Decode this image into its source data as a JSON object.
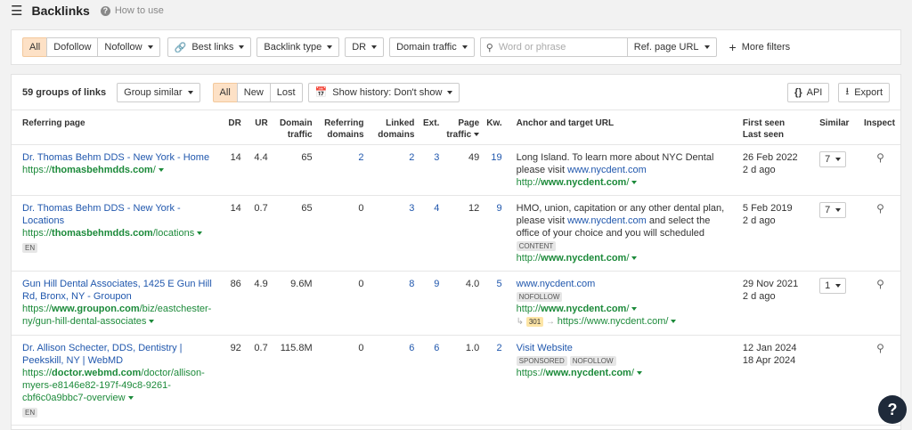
{
  "header": {
    "title": "Backlinks",
    "how_to": "How to use"
  },
  "filters": {
    "all": "All",
    "dofollow": "Dofollow",
    "nofollow": "Nofollow",
    "best_links": "Best links",
    "backlink_type": "Backlink type",
    "dr": "DR",
    "domain_traffic": "Domain traffic",
    "search_placeholder": "Word or phrase",
    "ref_page_url": "Ref. page URL",
    "more_filters": "More filters"
  },
  "toolbar": {
    "count": "59 groups of links",
    "group_similar": "Group similar",
    "all": "All",
    "new": "New",
    "lost": "Lost",
    "show_history": "Show history: Don't show",
    "api": "API",
    "export": "Export"
  },
  "columns": {
    "referring_page": "Referring page",
    "dr": "DR",
    "ur": "UR",
    "domain_traffic": "Domain traffic",
    "referring_domains": "Referring domains",
    "linked_domains": "Linked domains",
    "ext": "Ext.",
    "page_traffic": "Page traffic",
    "kw": "Kw.",
    "anchor": "Anchor and target URL",
    "first_seen": "First seen",
    "last_seen": "Last seen",
    "similar": "Similar",
    "inspect": "Inspect"
  },
  "rows": [
    {
      "title": "Dr. Thomas Behm DDS - New York - Home",
      "url_pre": "https://",
      "url_bold": "thomasbehmdds.com",
      "url_post": "/",
      "lang": "",
      "dr": "14",
      "ur": "4.4",
      "dtraffic": "65",
      "refdom": "2",
      "linked": "2",
      "ext": "3",
      "ptraffic": "49",
      "kw": "19",
      "anchor_text": "Long Island. To learn more about NYC Dental please visit ",
      "anchor_link": "www.nycdent.com",
      "anchor_after": "",
      "tags": "",
      "target_pre": "http://",
      "target_bold": "www.nycdent.com",
      "target_post": "/",
      "redirect": "",
      "redirect_target": "",
      "first": "26 Feb 2022",
      "last": "2 d ago",
      "similar": "7"
    },
    {
      "title": "Dr. Thomas Behm DDS - New York - Locations",
      "url_pre": "https://",
      "url_bold": "thomasbehmdds.com",
      "url_post": "/locations",
      "lang": "EN",
      "dr": "14",
      "ur": "0.7",
      "dtraffic": "65",
      "refdom": "0",
      "linked": "3",
      "ext": "4",
      "ptraffic": "12",
      "kw": "9",
      "anchor_text": "HMO, union, capitation or any other dental plan, please visit ",
      "anchor_link": "www.nycdent.com",
      "anchor_after": " and select the office of your choice and you will scheduled",
      "tags": "CONTENT",
      "target_pre": "http://",
      "target_bold": "www.nycdent.com",
      "target_post": "/",
      "redirect": "",
      "redirect_target": "",
      "first": "5 Feb 2019",
      "last": "2 d ago",
      "similar": "7"
    },
    {
      "title": "Gun Hill Dental Associates, 1425 E Gun Hill Rd, Bronx, NY - Groupon",
      "url_pre": "https://",
      "url_bold": "www.groupon.com",
      "url_post": "/biz/eastchester-ny/gun-hill-dental-associates",
      "lang": "",
      "dr": "86",
      "ur": "4.9",
      "dtraffic": "9.6M",
      "refdom": "0",
      "linked": "8",
      "ext": "9",
      "ptraffic": "4.0",
      "kw": "5",
      "anchor_text": "",
      "anchor_link": "www.nycdent.com",
      "anchor_after": "",
      "tags": "NOFOLLOW",
      "target_pre": "http://",
      "target_bold": "www.nycdent.com",
      "target_post": "/",
      "redirect": "301",
      "redirect_target": "https://www.nycdent.com/",
      "first": "29 Nov 2021",
      "last": "2 d ago",
      "similar": "1"
    },
    {
      "title": "Dr. Allison Schecter, DDS, Dentistry | Peekskill, NY | WebMD",
      "url_pre": "https://",
      "url_bold": "doctor.webmd.com",
      "url_post": "/doctor/allison-myers-e8146e82-197f-49c8-9261-cbf6c0a9bbc7-overview",
      "lang": "EN",
      "dr": "92",
      "ur": "0.7",
      "dtraffic": "115.8M",
      "refdom": "0",
      "linked": "6",
      "ext": "6",
      "ptraffic": "1.0",
      "kw": "2",
      "anchor_text": "",
      "anchor_link": "Visit Website",
      "anchor_after": "",
      "tags": "SPONSORED|NOFOLLOW",
      "target_pre": "https://",
      "target_bold": "www.nycdent.com",
      "target_post": "/",
      "redirect": "",
      "redirect_target": "",
      "first": "12 Jan 2024",
      "last": "18 Apr 2024",
      "similar": ""
    }
  ],
  "help": "?"
}
